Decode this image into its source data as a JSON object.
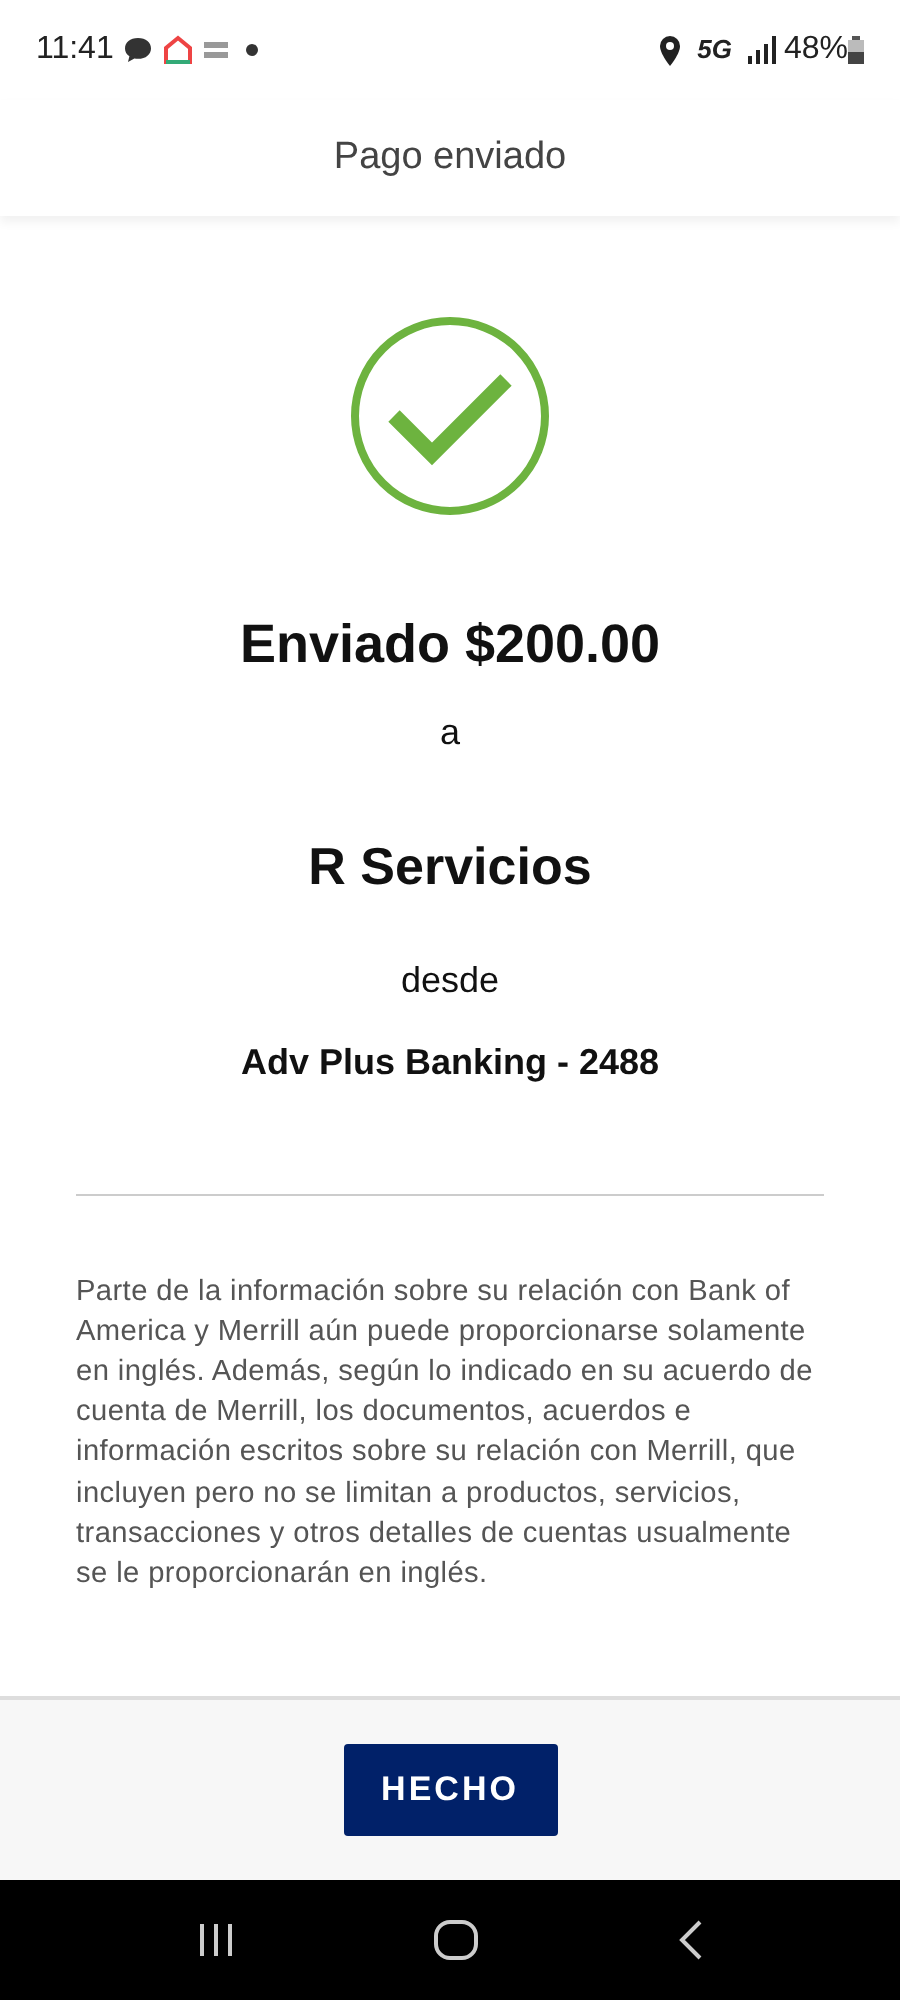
{
  "status_bar": {
    "time": "11:41",
    "network": "5G",
    "battery": "48%"
  },
  "header": {
    "title": "Pago enviado"
  },
  "confirmation": {
    "amount_line": "Enviado $200.00",
    "to_word": "a",
    "payee": "R Servicios",
    "from_word": "desde",
    "account": "Adv Plus Banking - 2488"
  },
  "disclaimer": "Parte de la información sobre su relación con Bank of America y Merrill aún puede proporcionarse solamente en inglés. Además, según lo indicado en su acuerdo de cuenta de Merrill, los documentos, acuerdos e información escritos sobre su relación con Merrill, que incluyen pero no se limitan a productos, servicios, transacciones y otros detalles de cuentas usualmente se le proporcionarán en inglés.",
  "buttons": [
    {
      "label": "HECHO"
    }
  ]
}
